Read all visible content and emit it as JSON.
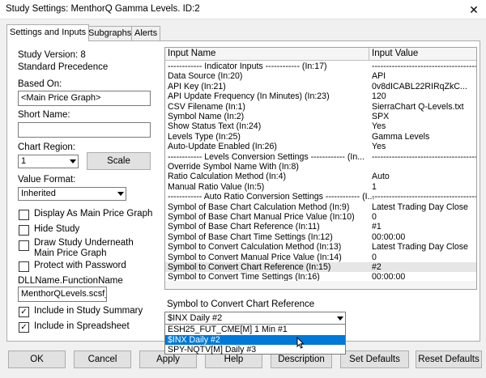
{
  "window": {
    "title": "Study Settings: MenthorQ Gamma Levels. ID:2",
    "close_glyph": "✕"
  },
  "tabs": [
    {
      "label": "Settings and Inputs",
      "active": true
    },
    {
      "label": "Subgraphs",
      "active": false
    },
    {
      "label": "Alerts",
      "active": false
    }
  ],
  "left": {
    "study_version": "Study Version: 8",
    "precedence": "Standard Precedence",
    "based_on_label": "Based On:",
    "based_on_value": "<Main Price Graph>",
    "short_name_label": "Short Name:",
    "short_name_value": "",
    "chart_region_label": "Chart Region:",
    "chart_region_value": "1",
    "scale_button": "Scale",
    "value_format_label": "Value Format:",
    "value_format_value": "Inherited",
    "checkboxes": [
      {
        "label": "Display As Main Price Graph",
        "checked": false
      },
      {
        "label": "Hide Study",
        "checked": false
      },
      {
        "label": "Draw Study Underneath",
        "label2": "Main Price Graph",
        "checked": false
      },
      {
        "label": "Protect with Password",
        "checked": false
      }
    ],
    "dll_label": "DLLName.FunctionName",
    "dll_value": "MenthorQLevels.scsf_",
    "include_summary": {
      "label": "Include in Study Summary",
      "checked": true
    },
    "include_spreadsheet": {
      "label": "Include in Spreadsheet",
      "checked": true
    }
  },
  "grid": {
    "col_name": "Input Name",
    "col_value": "Input Value",
    "rows": [
      {
        "name": "------------ Indicator Inputs ------------   (In:17)",
        "value": "---------------------------------------"
      },
      {
        "name": "Data Source  (In:20)",
        "value": "API"
      },
      {
        "name": "API Key   (In:21)",
        "value": "0v8dICABL22RIRqZkC..."
      },
      {
        "name": "API Update Frequency (In Minutes)  (In:23)",
        "value": "120"
      },
      {
        "name": "CSV Filename   (In:1)",
        "value": "SierraChart Q-Levels.txt"
      },
      {
        "name": "Symbol Name   (In:2)",
        "value": "SPX"
      },
      {
        "name": "Show Status Text   (In:24)",
        "value": "Yes"
      },
      {
        "name": "Levels Type   (In:25)",
        "value": "Gamma Levels"
      },
      {
        "name": "Auto-Update Enabled   (In:26)",
        "value": "Yes"
      },
      {
        "name": "------------ Levels Conversion Settings ------------   (In...",
        "value": "---------------------------------------"
      },
      {
        "name": "Override Symbol Name With   (In:8)",
        "value": ""
      },
      {
        "name": "Ratio Calculation Method   (In:4)",
        "value": "Auto"
      },
      {
        "name": "Manual Ratio Value   (In:5)",
        "value": "1"
      },
      {
        "name": "------------ Auto Ratio Conversion Settings ------------   (I...",
        "value": "---------------------------------------"
      },
      {
        "name": "Symbol of Base Chart Calculation Method   (In:9)",
        "value": "Latest Trading Day Close"
      },
      {
        "name": "Symbol of Base Chart Manual Price Value   (In:10)",
        "value": "0"
      },
      {
        "name": "Symbol of Base Chart Reference   (In:11)",
        "value": "#1"
      },
      {
        "name": "Symbol of Base Chart Time Settings   (In:12)",
        "value": "00:00:00"
      },
      {
        "name": "Symbol to Convert Calculation Method   (In:13)",
        "value": "Latest Trading Day Close"
      },
      {
        "name": "Symbol to Convert Manual Price Value   (In:14)",
        "value": "0"
      },
      {
        "name": "Symbol to Convert Chart Reference   (In:15)",
        "value": "#2"
      },
      {
        "name": "Symbol to Convert Time Settings   (In:16)",
        "value": "00:00:00"
      }
    ]
  },
  "editor": {
    "label": "Symbol to Convert Chart Reference",
    "value": "$INX  Daily #2",
    "options": [
      {
        "label": "ESH25_FUT_CME[M]  1 Min  #1",
        "selected": false
      },
      {
        "label": "$INX  Daily #2",
        "selected": true
      },
      {
        "label": "SPY-NQTV[M]  Daily #3",
        "selected": false
      }
    ]
  },
  "buttons": {
    "ok": "OK",
    "cancel": "Cancel",
    "apply": "Apply",
    "help": "Help",
    "description": "Description",
    "set_defaults": "Set Defaults",
    "reset_defaults": "Reset Defaults"
  },
  "colors": {
    "selection": "#0078d7",
    "panel": "#ffffff",
    "background": "#f0f0f0"
  }
}
